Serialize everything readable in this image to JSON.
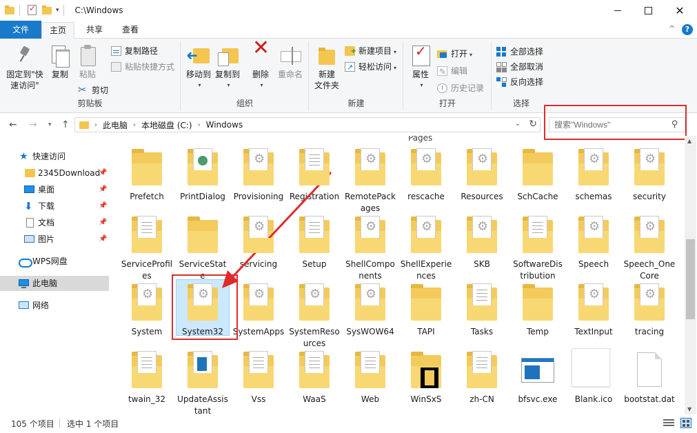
{
  "window": {
    "title": "C:\\Windows"
  },
  "ribbon": {
    "tabs": [
      "文件",
      "主页",
      "共享",
      "查看"
    ],
    "clipboard": {
      "pin_quick_access": "固定到\"快\n速访问\"",
      "copy": "复制",
      "paste": "粘贴",
      "copy_path": "复制路径",
      "paste_shortcut": "粘贴快捷方式",
      "cut": "剪切",
      "label": "剪贴板"
    },
    "organize": {
      "move_to": "移动到",
      "copy_to": "复制到",
      "delete": "删除",
      "rename": "重命名",
      "label": "组织"
    },
    "new": {
      "new_folder": "新建\n文件夹",
      "new_item": "新建项目",
      "easy_access": "轻松访问",
      "label": "新建"
    },
    "open": {
      "properties": "属性",
      "open": "打开",
      "edit": "编辑",
      "history": "历史记录",
      "label": "打开"
    },
    "select": {
      "select_all": "全部选择",
      "select_none": "全部取消",
      "invert": "反向选择",
      "label": "选择"
    }
  },
  "address": {
    "crumbs": [
      "此电脑",
      "本地磁盘 (C:)",
      "Windows"
    ],
    "search_placeholder": "搜索\"Windows\""
  },
  "nav_pane": {
    "quick_access": "快速访问",
    "items": [
      {
        "label": "2345Download",
        "pinned": true
      },
      {
        "label": "桌面",
        "pinned": true
      },
      {
        "label": "下载",
        "pinned": true
      },
      {
        "label": "文档",
        "pinned": true
      },
      {
        "label": "图片",
        "pinned": true
      }
    ],
    "wps": "WPS网盘",
    "this_pc": "此电脑",
    "network": "网络"
  },
  "content": {
    "partial_top_label": "Pages",
    "rows": [
      [
        "Prefetch",
        "PrintDialog",
        "Provisioning",
        "Registration",
        "RemotePackages",
        "rescache",
        "Resources",
        "SchCache",
        "schemas",
        "security"
      ],
      [
        "ServiceProfiles",
        "ServiceState",
        "servicing",
        "Setup",
        "ShellComponents",
        "ShellExperiences",
        "SKB",
        "SoftwareDistribution",
        "Speech",
        "Speech_OneCore"
      ],
      [
        "System",
        "System32",
        "SystemApps",
        "SystemResources",
        "SysWOW64",
        "TAPI",
        "Tasks",
        "Temp",
        "TextInput",
        "tracing"
      ],
      [
        "twain_32",
        "UpdateAssistant",
        "Vss",
        "WaaS",
        "Web",
        "WinSxS",
        "zh-CN",
        "bfsvc.exe",
        "Blank.ico",
        "bootstat.dat"
      ]
    ],
    "selected": "System32"
  },
  "status": {
    "count": "105 个项目",
    "selection": "选中 1 个项目"
  },
  "colors": {
    "accent": "#1979ca",
    "highlight_red": "#e02b2b",
    "selection": "#cce8ff",
    "folder": "#f3cb5c"
  }
}
